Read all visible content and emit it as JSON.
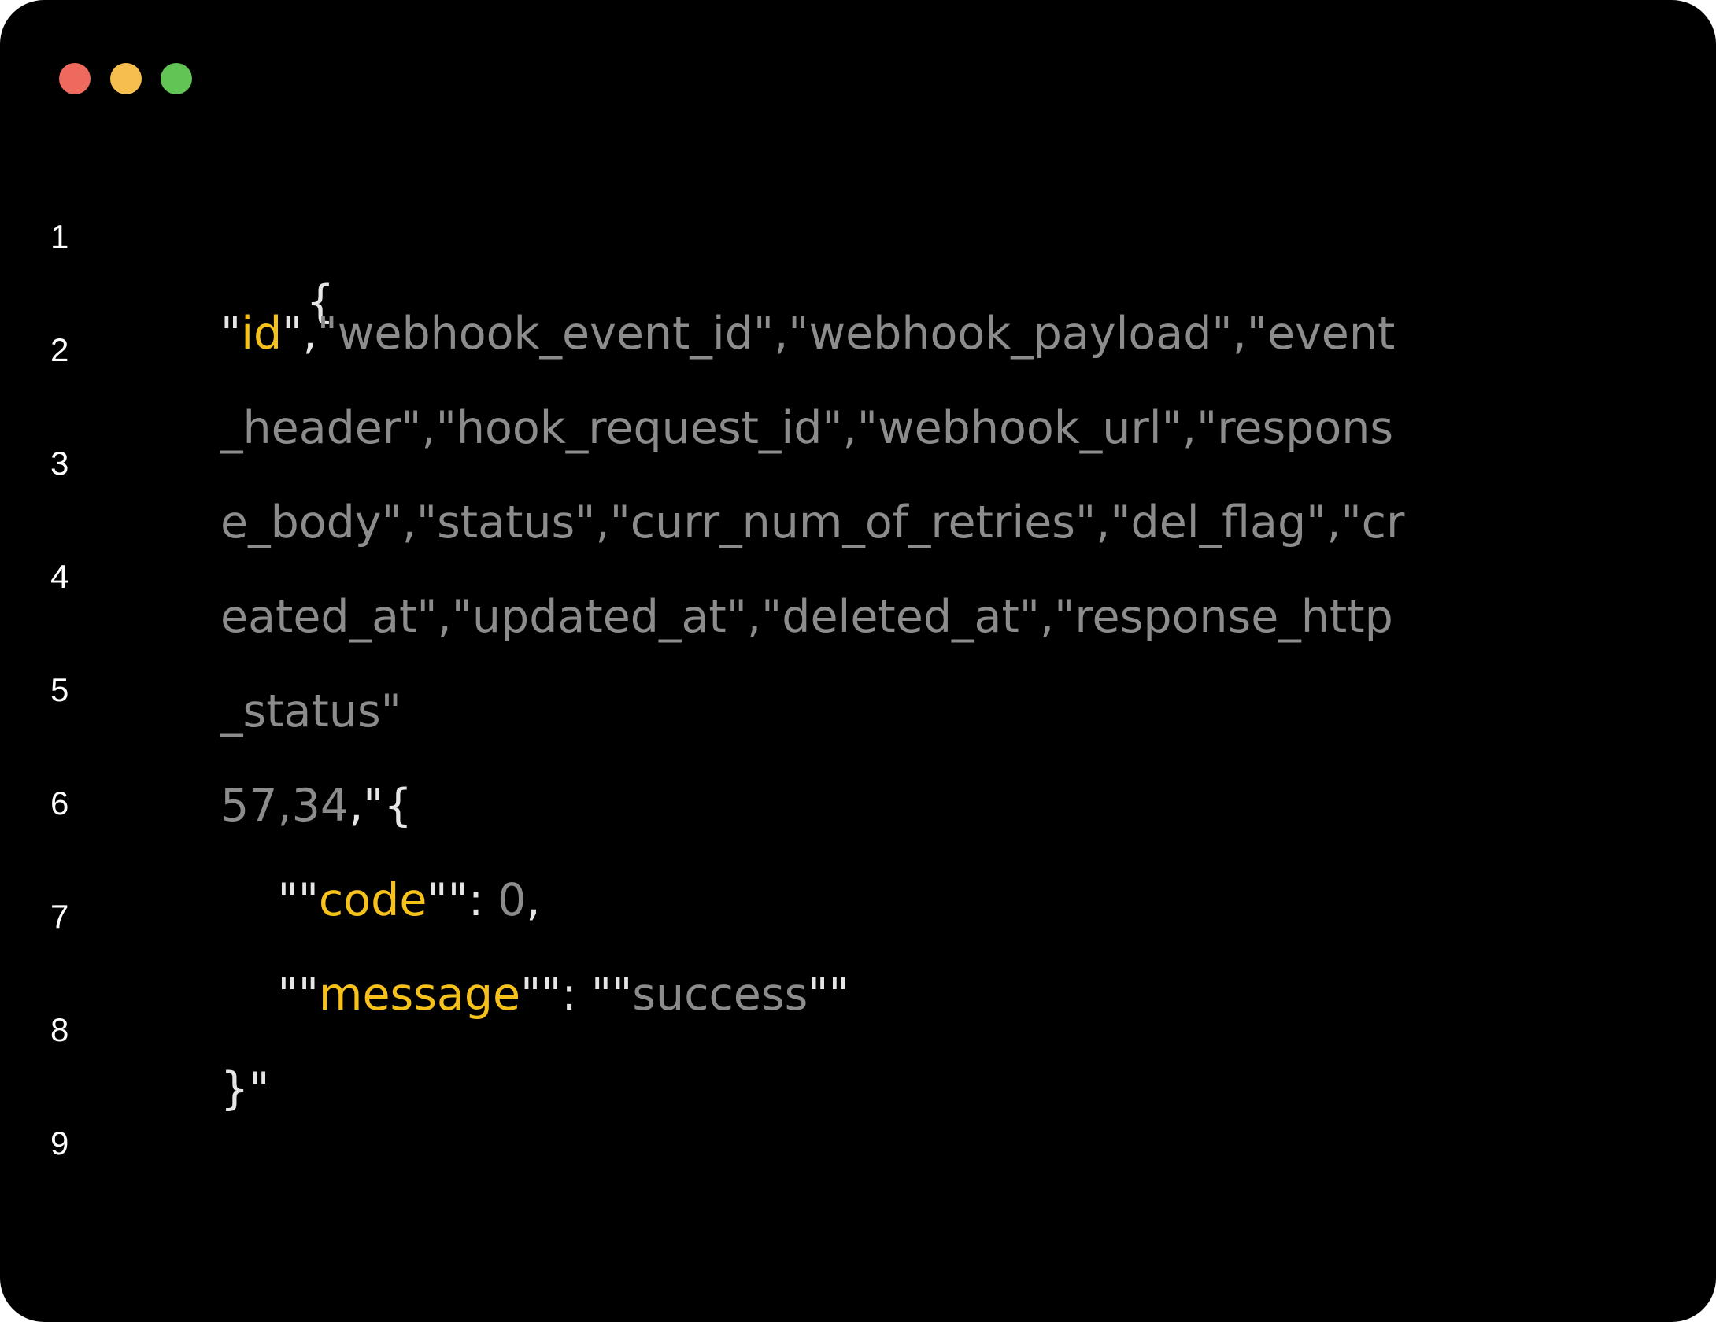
{
  "window_controls": {
    "close_color": "#ee6a5f",
    "minimize_color": "#f5be4f",
    "maximize_color": "#61c454"
  },
  "colors": {
    "background": "#000000",
    "line_number": "#ffffff",
    "text": "#8c8c8c",
    "punctuation": "#e6e6e6",
    "key": "#f6c11a"
  },
  "gutter": {
    "line_numbers": [
      "1",
      "2",
      "3",
      "4",
      "5",
      "6",
      "7",
      "8",
      "9"
    ]
  },
  "code": {
    "line1": {
      "brace": "{"
    },
    "line2": {
      "q1": "\"",
      "key": "id",
      "q2": "\",",
      "rest": "\"webhook_event_id\",\"webhook_payload\",\"event"
    },
    "line3": {
      "text": "_header\",\"hook_request_id\",\"webhook_url\",\"respons"
    },
    "line4": {
      "text": "e_body\",\"status\",\"curr_num_of_retries\",\"del_flag\",\"cr"
    },
    "line5": {
      "text": "eated_at\",\"updated_at\",\"deleted_at\",\"response_http"
    },
    "line6": {
      "text": "_status\""
    },
    "line7": {
      "num": "57,34",
      "punct": ",\"{"
    },
    "line8": {
      "indent": "    ",
      "q1": "\"\"",
      "key": "code",
      "q2": "\"\": ",
      "value": "0",
      "comma": ","
    },
    "line9": {
      "indent": "    ",
      "q1": "\"\"",
      "key": "message",
      "q2": "\"\": \"\"",
      "value": "success",
      "q3": "\"\""
    },
    "line10": {
      "text": "}\""
    }
  }
}
